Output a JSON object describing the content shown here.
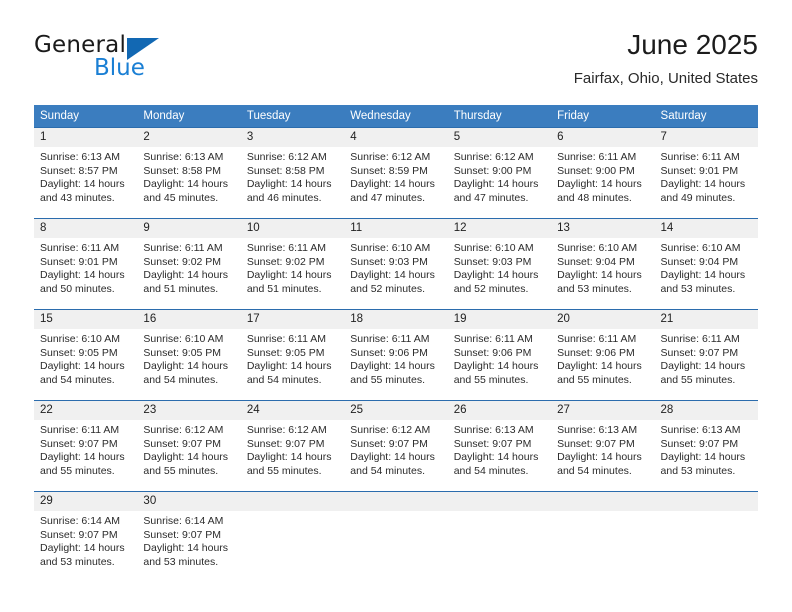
{
  "brand": {
    "name_top": "General",
    "name_bottom": "Blue",
    "triangle_color": "#1268b3",
    "blue_text_color": "#1a7fd4"
  },
  "header": {
    "title": "June 2025",
    "subtitle": "Fairfax, Ohio, United States"
  },
  "theme": {
    "header_bg": "#3b7dbf",
    "header_text": "#ffffff",
    "row_border": "#2b6cad",
    "daynum_bg": "#f0f0f0",
    "cell_bg": "#ffffff",
    "body_text": "#2b2b2b"
  },
  "weekday_headers": [
    "Sunday",
    "Monday",
    "Tuesday",
    "Wednesday",
    "Thursday",
    "Friday",
    "Saturday"
  ],
  "labels": {
    "sunrise_prefix": "Sunrise:",
    "sunset_prefix": "Sunset:",
    "daylight_prefix": "Daylight:"
  },
  "weeks": [
    [
      {
        "day": "1",
        "sunrise": "Sunrise: 6:13 AM",
        "sunset": "Sunset: 8:57 PM",
        "daylight_line1": "Daylight: 14 hours",
        "daylight_line2": "and 43 minutes."
      },
      {
        "day": "2",
        "sunrise": "Sunrise: 6:13 AM",
        "sunset": "Sunset: 8:58 PM",
        "daylight_line1": "Daylight: 14 hours",
        "daylight_line2": "and 45 minutes."
      },
      {
        "day": "3",
        "sunrise": "Sunrise: 6:12 AM",
        "sunset": "Sunset: 8:58 PM",
        "daylight_line1": "Daylight: 14 hours",
        "daylight_line2": "and 46 minutes."
      },
      {
        "day": "4",
        "sunrise": "Sunrise: 6:12 AM",
        "sunset": "Sunset: 8:59 PM",
        "daylight_line1": "Daylight: 14 hours",
        "daylight_line2": "and 47 minutes."
      },
      {
        "day": "5",
        "sunrise": "Sunrise: 6:12 AM",
        "sunset": "Sunset: 9:00 PM",
        "daylight_line1": "Daylight: 14 hours",
        "daylight_line2": "and 47 minutes."
      },
      {
        "day": "6",
        "sunrise": "Sunrise: 6:11 AM",
        "sunset": "Sunset: 9:00 PM",
        "daylight_line1": "Daylight: 14 hours",
        "daylight_line2": "and 48 minutes."
      },
      {
        "day": "7",
        "sunrise": "Sunrise: 6:11 AM",
        "sunset": "Sunset: 9:01 PM",
        "daylight_line1": "Daylight: 14 hours",
        "daylight_line2": "and 49 minutes."
      }
    ],
    [
      {
        "day": "8",
        "sunrise": "Sunrise: 6:11 AM",
        "sunset": "Sunset: 9:01 PM",
        "daylight_line1": "Daylight: 14 hours",
        "daylight_line2": "and 50 minutes."
      },
      {
        "day": "9",
        "sunrise": "Sunrise: 6:11 AM",
        "sunset": "Sunset: 9:02 PM",
        "daylight_line1": "Daylight: 14 hours",
        "daylight_line2": "and 51 minutes."
      },
      {
        "day": "10",
        "sunrise": "Sunrise: 6:11 AM",
        "sunset": "Sunset: 9:02 PM",
        "daylight_line1": "Daylight: 14 hours",
        "daylight_line2": "and 51 minutes."
      },
      {
        "day": "11",
        "sunrise": "Sunrise: 6:10 AM",
        "sunset": "Sunset: 9:03 PM",
        "daylight_line1": "Daylight: 14 hours",
        "daylight_line2": "and 52 minutes."
      },
      {
        "day": "12",
        "sunrise": "Sunrise: 6:10 AM",
        "sunset": "Sunset: 9:03 PM",
        "daylight_line1": "Daylight: 14 hours",
        "daylight_line2": "and 52 minutes."
      },
      {
        "day": "13",
        "sunrise": "Sunrise: 6:10 AM",
        "sunset": "Sunset: 9:04 PM",
        "daylight_line1": "Daylight: 14 hours",
        "daylight_line2": "and 53 minutes."
      },
      {
        "day": "14",
        "sunrise": "Sunrise: 6:10 AM",
        "sunset": "Sunset: 9:04 PM",
        "daylight_line1": "Daylight: 14 hours",
        "daylight_line2": "and 53 minutes."
      }
    ],
    [
      {
        "day": "15",
        "sunrise": "Sunrise: 6:10 AM",
        "sunset": "Sunset: 9:05 PM",
        "daylight_line1": "Daylight: 14 hours",
        "daylight_line2": "and 54 minutes."
      },
      {
        "day": "16",
        "sunrise": "Sunrise: 6:10 AM",
        "sunset": "Sunset: 9:05 PM",
        "daylight_line1": "Daylight: 14 hours",
        "daylight_line2": "and 54 minutes."
      },
      {
        "day": "17",
        "sunrise": "Sunrise: 6:11 AM",
        "sunset": "Sunset: 9:05 PM",
        "daylight_line1": "Daylight: 14 hours",
        "daylight_line2": "and 54 minutes."
      },
      {
        "day": "18",
        "sunrise": "Sunrise: 6:11 AM",
        "sunset": "Sunset: 9:06 PM",
        "daylight_line1": "Daylight: 14 hours",
        "daylight_line2": "and 55 minutes."
      },
      {
        "day": "19",
        "sunrise": "Sunrise: 6:11 AM",
        "sunset": "Sunset: 9:06 PM",
        "daylight_line1": "Daylight: 14 hours",
        "daylight_line2": "and 55 minutes."
      },
      {
        "day": "20",
        "sunrise": "Sunrise: 6:11 AM",
        "sunset": "Sunset: 9:06 PM",
        "daylight_line1": "Daylight: 14 hours",
        "daylight_line2": "and 55 minutes."
      },
      {
        "day": "21",
        "sunrise": "Sunrise: 6:11 AM",
        "sunset": "Sunset: 9:07 PM",
        "daylight_line1": "Daylight: 14 hours",
        "daylight_line2": "and 55 minutes."
      }
    ],
    [
      {
        "day": "22",
        "sunrise": "Sunrise: 6:11 AM",
        "sunset": "Sunset: 9:07 PM",
        "daylight_line1": "Daylight: 14 hours",
        "daylight_line2": "and 55 minutes."
      },
      {
        "day": "23",
        "sunrise": "Sunrise: 6:12 AM",
        "sunset": "Sunset: 9:07 PM",
        "daylight_line1": "Daylight: 14 hours",
        "daylight_line2": "and 55 minutes."
      },
      {
        "day": "24",
        "sunrise": "Sunrise: 6:12 AM",
        "sunset": "Sunset: 9:07 PM",
        "daylight_line1": "Daylight: 14 hours",
        "daylight_line2": "and 55 minutes."
      },
      {
        "day": "25",
        "sunrise": "Sunrise: 6:12 AM",
        "sunset": "Sunset: 9:07 PM",
        "daylight_line1": "Daylight: 14 hours",
        "daylight_line2": "and 54 minutes."
      },
      {
        "day": "26",
        "sunrise": "Sunrise: 6:13 AM",
        "sunset": "Sunset: 9:07 PM",
        "daylight_line1": "Daylight: 14 hours",
        "daylight_line2": "and 54 minutes."
      },
      {
        "day": "27",
        "sunrise": "Sunrise: 6:13 AM",
        "sunset": "Sunset: 9:07 PM",
        "daylight_line1": "Daylight: 14 hours",
        "daylight_line2": "and 54 minutes."
      },
      {
        "day": "28",
        "sunrise": "Sunrise: 6:13 AM",
        "sunset": "Sunset: 9:07 PM",
        "daylight_line1": "Daylight: 14 hours",
        "daylight_line2": "and 53 minutes."
      }
    ],
    [
      {
        "day": "29",
        "sunrise": "Sunrise: 6:14 AM",
        "sunset": "Sunset: 9:07 PM",
        "daylight_line1": "Daylight: 14 hours",
        "daylight_line2": "and 53 minutes."
      },
      {
        "day": "30",
        "sunrise": "Sunrise: 6:14 AM",
        "sunset": "Sunset: 9:07 PM",
        "daylight_line1": "Daylight: 14 hours",
        "daylight_line2": "and 53 minutes."
      },
      {
        "day": "",
        "sunrise": "",
        "sunset": "",
        "daylight_line1": "",
        "daylight_line2": ""
      },
      {
        "day": "",
        "sunrise": "",
        "sunset": "",
        "daylight_line1": "",
        "daylight_line2": ""
      },
      {
        "day": "",
        "sunrise": "",
        "sunset": "",
        "daylight_line1": "",
        "daylight_line2": ""
      },
      {
        "day": "",
        "sunrise": "",
        "sunset": "",
        "daylight_line1": "",
        "daylight_line2": ""
      },
      {
        "day": "",
        "sunrise": "",
        "sunset": "",
        "daylight_line1": "",
        "daylight_line2": ""
      }
    ]
  ]
}
